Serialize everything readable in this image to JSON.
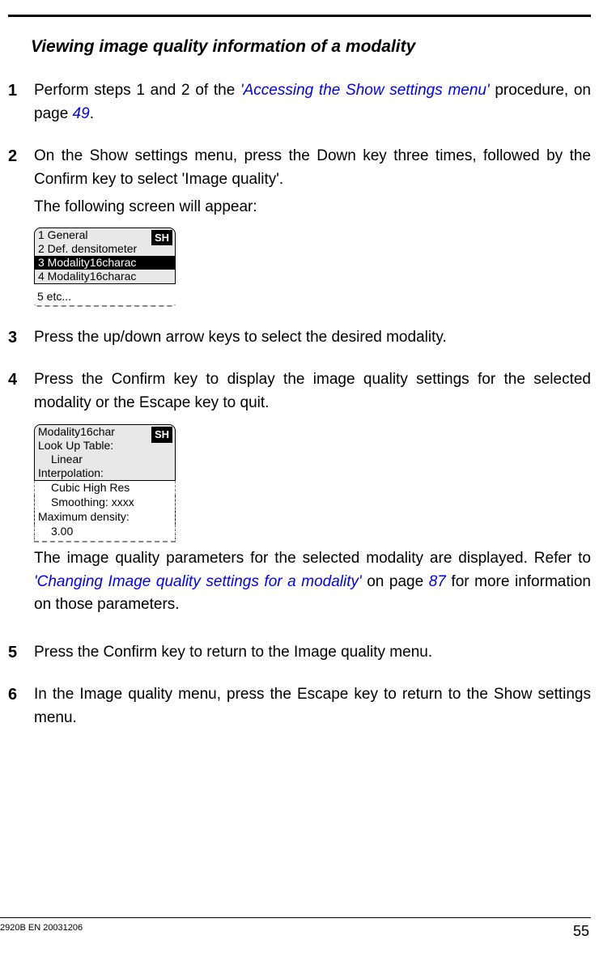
{
  "section_title": "Viewing image quality information of a modality",
  "steps": [
    {
      "num": "1",
      "text_before": "Perform steps 1 and 2 of the ",
      "link": "'Accessing the Show settings menu'",
      "text_mid": " procedure, on page ",
      "page_ref": "49",
      "text_after": "."
    },
    {
      "num": "2",
      "para1": "On the Show settings menu, press the Down key three times, followed by the Confirm key to select 'Image quality'.",
      "para2": "The following screen will appear:",
      "screen": {
        "badge": "SH",
        "rows": [
          {
            "text": "1 General",
            "selected": false
          },
          {
            "text": "2 Def. densitometer",
            "selected": false
          },
          {
            "text": "3 Modality16charac",
            "selected": true
          },
          {
            "text": "4 Modality16charac",
            "selected": false
          }
        ],
        "etc": "5 etc..."
      }
    },
    {
      "num": "3",
      "text": "Press the up/down arrow keys to select the desired modality."
    },
    {
      "num": "4",
      "para1": "Press the Confirm key to display the image quality settings for the selected modality or the Escape key to quit.",
      "screen": {
        "badge": "SH",
        "top_rows": [
          "Modality16char",
          "Look Up Table:",
          "    Linear",
          "Interpolation:"
        ],
        "bottom_rows": [
          "Cubic High Res",
          "Smoothing: xxxx",
          "Maximum density:",
          "3.00"
        ]
      },
      "para2_before": "The image quality parameters for the selected modality are displayed. Refer to ",
      "para2_link": "'Changing Image quality settings for a modality'",
      "para2_mid": " on page ",
      "para2_ref": "87",
      "para2_after": " for more information on those parameters."
    },
    {
      "num": "5",
      "text": "Press the Confirm key to return to the Image quality menu."
    },
    {
      "num": "6",
      "text": "In the Image quality menu, press the Escape key to return to the Show settings menu."
    }
  ],
  "footer": {
    "doc_id": "2920B EN 20031206",
    "page": "55"
  }
}
